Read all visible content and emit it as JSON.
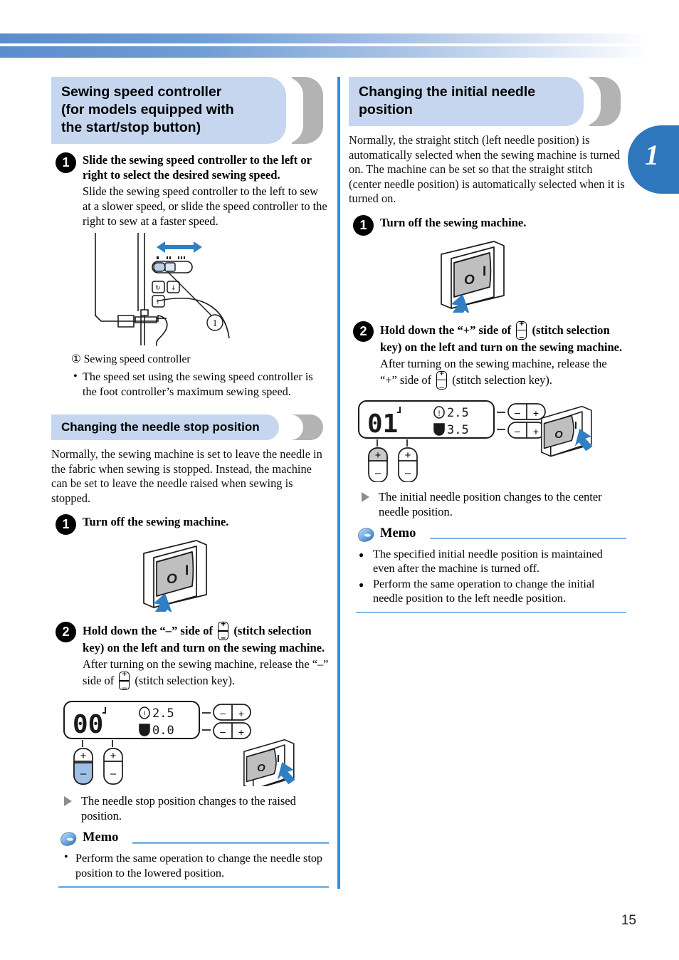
{
  "page": {
    "number": "15",
    "chapter_tab": "1"
  },
  "left": {
    "section1": {
      "heading": "Sewing speed controller (for models equipped with the start/stop button)",
      "heading_lines": [
        "Sewing speed controller",
        "(for models equipped with",
        "the start/stop button)"
      ],
      "step1": {
        "num": "1",
        "lead": "Slide the sewing speed controller to the left or right to select the desired sewing speed.",
        "sub": "Slide the sewing speed controller to the left to sew at a slower speed, or slide the speed controller to the right to sew at a faster speed."
      },
      "callout_label": "① Sewing speed controller",
      "figure": {
        "callout_number": "①",
        "arrow": "double-headed-horizontal"
      },
      "bullets": [
        "The speed set using the sewing speed controller is the foot controller’s maximum sewing speed."
      ]
    },
    "section2": {
      "heading": "Changing the needle stop position",
      "intro": "Normally, the sewing machine is set to leave the needle in the fabric when sewing is stopped. Instead, the machine can be set to leave the needle raised when sewing is stopped.",
      "step1": {
        "num": "1",
        "lead": "Turn off the sewing machine."
      },
      "switch_off": {
        "off_label": "O",
        "on_label": "I"
      },
      "step2": {
        "num": "2",
        "lead_a": "Hold down the “–” side of",
        "lead_b": "(stitch selection key) on the left and turn on the sewing machine.",
        "sub_a": "After turning on the sewing machine, release the “–” side of",
        "sub_b": "(stitch selection key)."
      },
      "lcd": {
        "digits": "00",
        "width_value": "2.5",
        "length_value": "0.0",
        "marker": "needle-up-mark",
        "highlight": "left-key-minus"
      },
      "switch_on": {
        "off_label": "O",
        "on_label": "I"
      },
      "result": "The needle stop position changes to the raised position.",
      "memo": {
        "title": "Memo",
        "items": [
          "Perform the same operation to change the needle stop position to the lowered position."
        ]
      }
    }
  },
  "right": {
    "section": {
      "heading": "Changing the initial needle position",
      "heading_lines": [
        "Changing the initial needle",
        "position"
      ],
      "intro": "Normally, the straight stitch (left needle position) is automatically selected when the sewing machine is turned on. The machine can be set so that the straight stitch (center needle position) is automatically selected when it is turned on.",
      "step1": {
        "num": "1",
        "lead": "Turn off the sewing machine."
      },
      "switch_off": {
        "off_label": "O",
        "on_label": "I"
      },
      "step2": {
        "num": "2",
        "lead_a": "Hold down the “+” side of",
        "lead_b": "(stitch selection key) on the left and turn on the sewing machine.",
        "sub_a": "After turning on the sewing machine, release the “+” side of",
        "sub_b": "(stitch selection key)."
      },
      "lcd": {
        "digits": "01",
        "width_value": "2.5",
        "length_value": "3.5",
        "marker": "needle-up-mark",
        "highlight": "left-key-plus"
      },
      "switch_on": {
        "off_label": "O",
        "on_label": "I"
      },
      "result": "The initial needle position changes to the center needle position.",
      "memo": {
        "title": "Memo",
        "items": [
          "The specified initial needle position is maintained even after the machine is turned off.",
          "Perform the same operation to change the initial needle position to the left needle position."
        ]
      }
    }
  },
  "colors": {
    "accent_blue": "#2f77bc",
    "heading_band": "#c6d6ee",
    "memo_rule": "#7fb6ea",
    "arrow_blue": "#2f7fc4"
  }
}
